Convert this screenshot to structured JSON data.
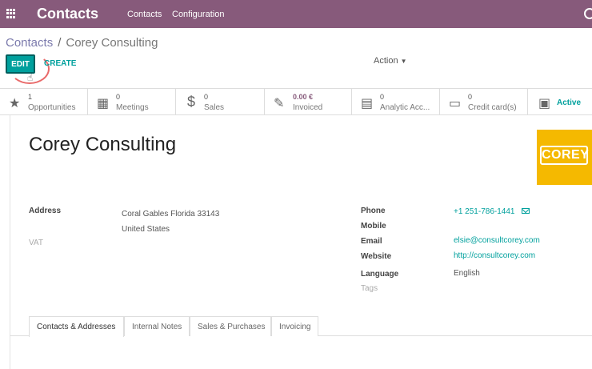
{
  "navbar": {
    "brand": "Contacts",
    "menu": [
      "Contacts",
      "Configuration"
    ]
  },
  "breadcrumb": {
    "parent": "Contacts",
    "separator": "/",
    "current": "Corey Consulting"
  },
  "toolbar": {
    "edit_label": "EDIT",
    "create_label": "CREATE",
    "action_label": "Action"
  },
  "smart_buttons": [
    {
      "icon": "star-icon",
      "value": "1",
      "label": "Opportunities"
    },
    {
      "icon": "calendar-icon",
      "value": "0",
      "label": "Meetings"
    },
    {
      "icon": "dollar-icon",
      "value": "0",
      "label": "Sales"
    },
    {
      "icon": "pencil-square-icon",
      "value": "0.00 €",
      "label": "Invoiced"
    },
    {
      "icon": "book-icon",
      "value": "0",
      "label": "Analytic Acc..."
    },
    {
      "icon": "credit-card-icon",
      "value": "0",
      "label": "Credit card(s)"
    },
    {
      "icon": "archive-icon",
      "value": "",
      "label": "Active"
    }
  ],
  "partner": {
    "name": "Corey Consulting",
    "logo_text": "COREY",
    "address_label": "Address",
    "address_line1": "Coral Gables  Florida  33143",
    "address_line2": "United States",
    "vat_label": "VAT",
    "phone_label": "Phone",
    "phone": "+1 251-786-1441",
    "mobile_label": "Mobile",
    "email_label": "Email",
    "email": "elsie@consultcorey.com",
    "website_label": "Website",
    "website": "http://consultcorey.com",
    "language_label": "Language",
    "language": "English",
    "tags_label": "Tags"
  },
  "tabs": [
    "Contacts & Addresses",
    "Internal Notes",
    "Sales & Purchases",
    "Invoicing"
  ],
  "colors": {
    "navbar": "#875a7b",
    "primary": "#00a09d",
    "logo_bg": "#f5b900"
  }
}
